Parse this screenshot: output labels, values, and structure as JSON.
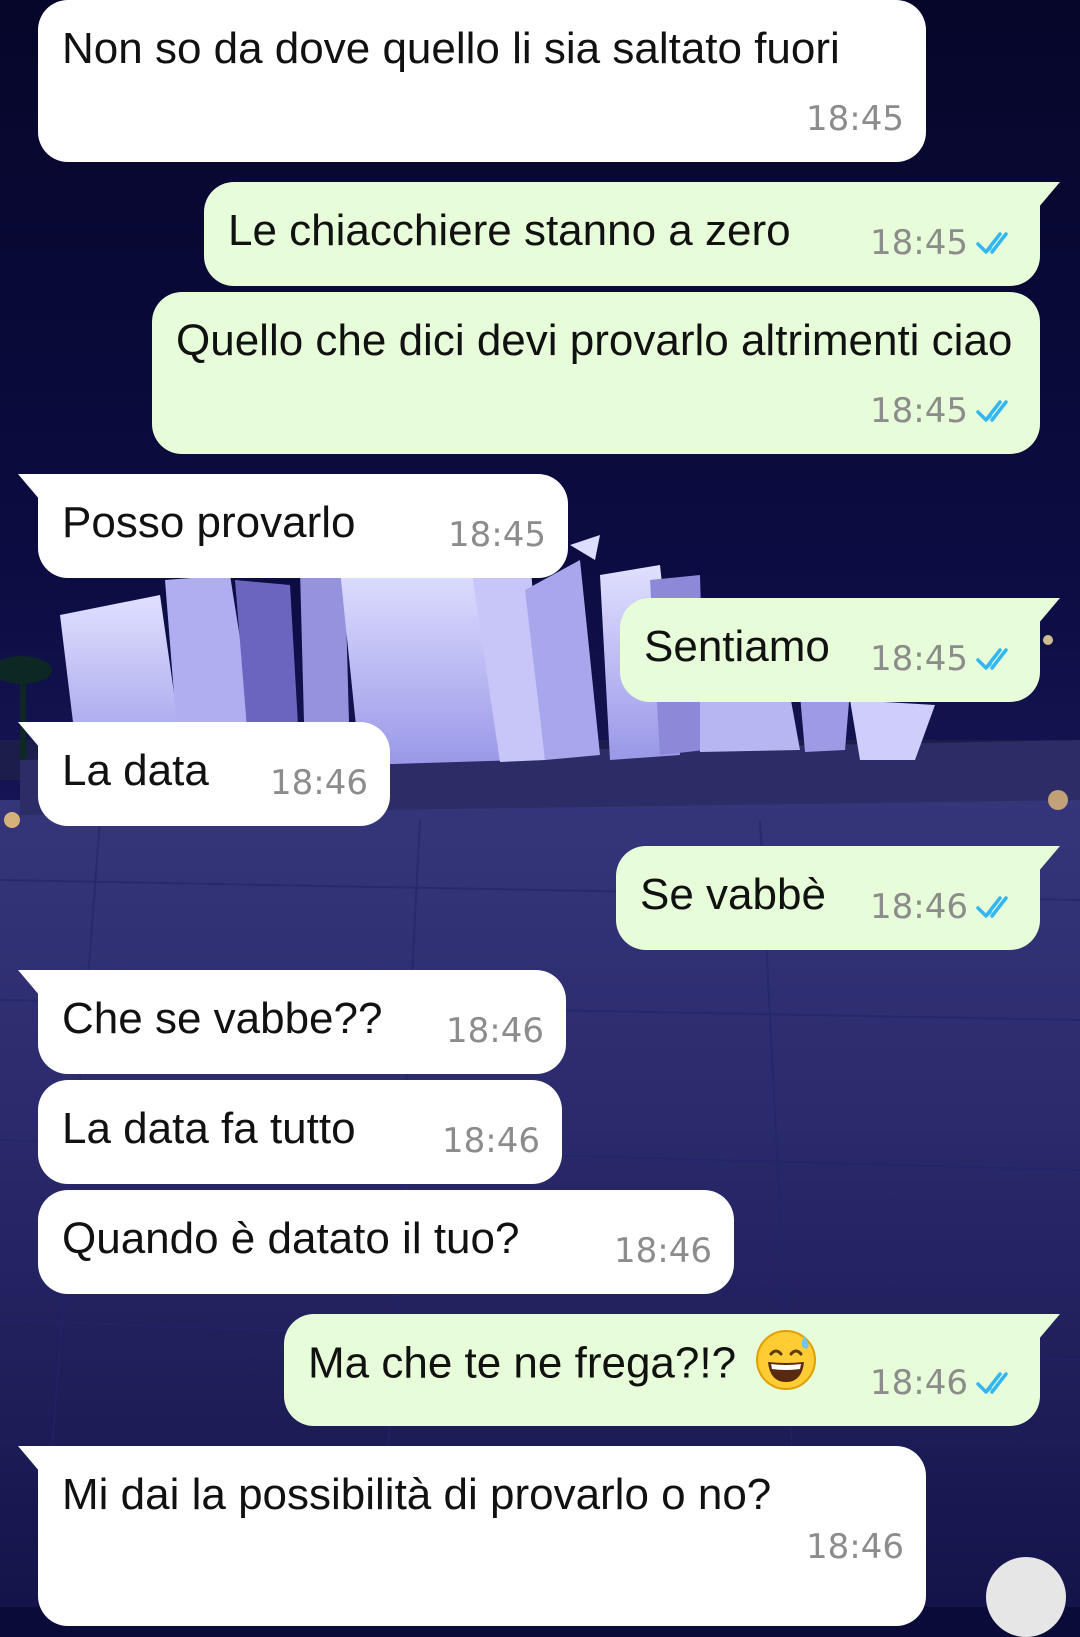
{
  "chat": {
    "messages": [
      {
        "direction": "in",
        "text": "Non so da dove quello li sia saltato fuori",
        "time": "18:45"
      },
      {
        "direction": "out",
        "text": "Le chiacchiere stanno a zero",
        "time": "18:45",
        "status": "read"
      },
      {
        "direction": "out",
        "text": "Quello che dici devi provarlo altrimenti ciao",
        "time": "18:45",
        "status": "read"
      },
      {
        "direction": "in",
        "text": "Posso provarlo",
        "time": "18:45"
      },
      {
        "direction": "out",
        "text": "Sentiamo",
        "time": "18:45",
        "status": "read"
      },
      {
        "direction": "in",
        "text": "La data",
        "time": "18:46"
      },
      {
        "direction": "out",
        "text": "Se vabbè",
        "time": "18:46",
        "status": "read"
      },
      {
        "direction": "in",
        "text": "Che se vabbe??",
        "time": "18:46"
      },
      {
        "direction": "in",
        "text": "La data fa tutto",
        "time": "18:46"
      },
      {
        "direction": "in",
        "text": "Quando è datato il tuo?",
        "time": "18:46"
      },
      {
        "direction": "out",
        "text": "Ma che te ne frega?!?",
        "emoji": "grinning-face-with-sweat",
        "time": "18:46",
        "status": "read"
      },
      {
        "direction": "in",
        "text": "Mi dai la possibilità di provarlo o no?",
        "time": "18:46"
      }
    ]
  },
  "colors": {
    "incoming_bubble": "#ffffff",
    "outgoing_bubble": "#e7fcd8",
    "timestamp": "#8c8c8c",
    "read_check": "#34b7f1"
  },
  "icons": {
    "read_receipt": "double-check-icon",
    "scroll_down": "scroll-down-button"
  }
}
